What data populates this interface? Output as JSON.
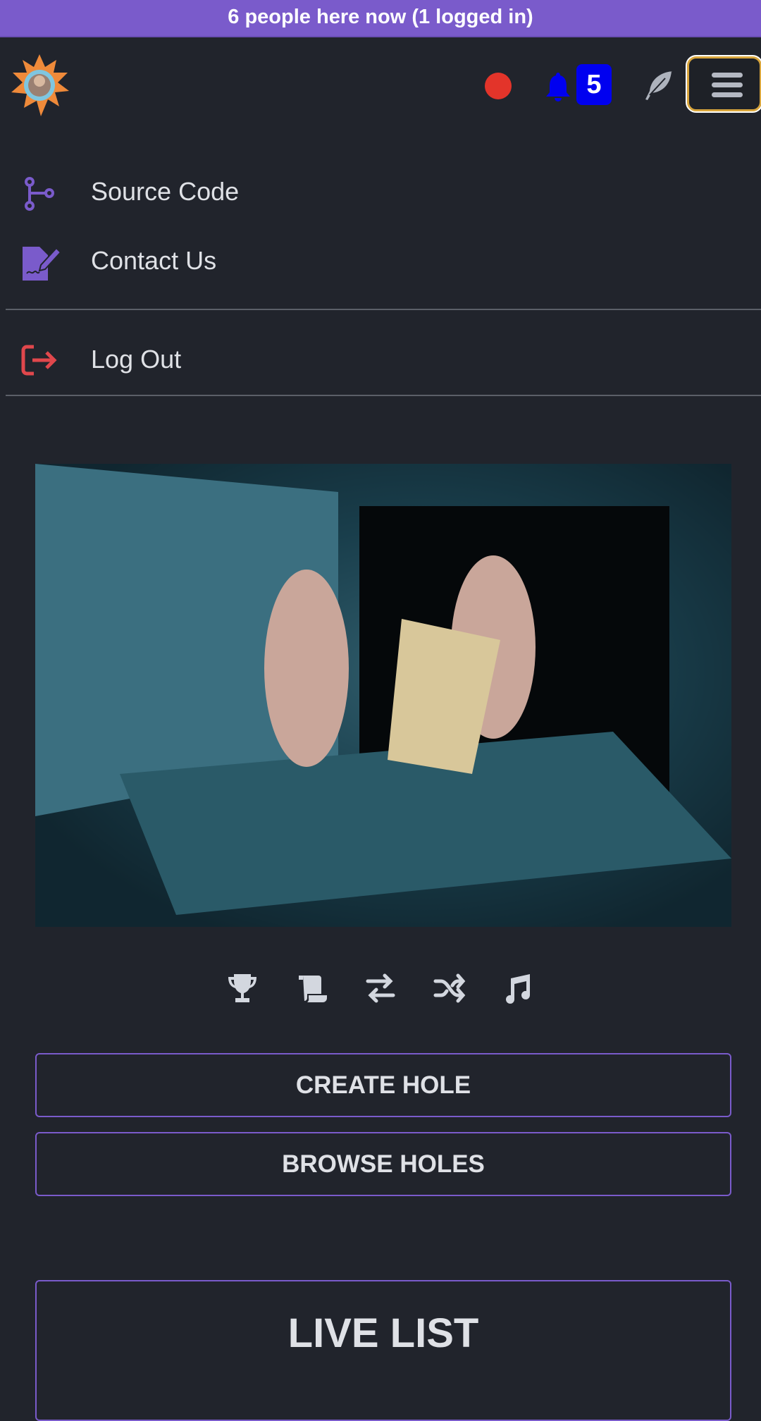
{
  "banner": {
    "text": "6 people here now (1 logged in)"
  },
  "header": {
    "notification_count": "5",
    "recording_color": "#e3342a",
    "badge_color": "#0000f0",
    "icons": [
      "logo",
      "record-dot",
      "bell-icon",
      "feather-icon",
      "hamburger-icon"
    ]
  },
  "menu": {
    "items": [
      {
        "label": "Source Code",
        "icon": "git-branch-icon"
      },
      {
        "label": "Contact Us",
        "icon": "edit-document-icon"
      },
      {
        "label": "Log Out",
        "icon": "logout-icon"
      }
    ]
  },
  "toolbar": {
    "icons": [
      "trophy-icon",
      "scroll-icon",
      "swap-icon",
      "shuffle-icon",
      "music-icon"
    ]
  },
  "actions": {
    "create": "CREATE HOLE",
    "browse": "BROWSE HOLES"
  },
  "live_list": {
    "title": "LIVE LIST"
  },
  "colors": {
    "accent": "#7a5bcb",
    "background": "#21242c",
    "logout": "#e0474c",
    "menu_border": "#d8a53c"
  }
}
